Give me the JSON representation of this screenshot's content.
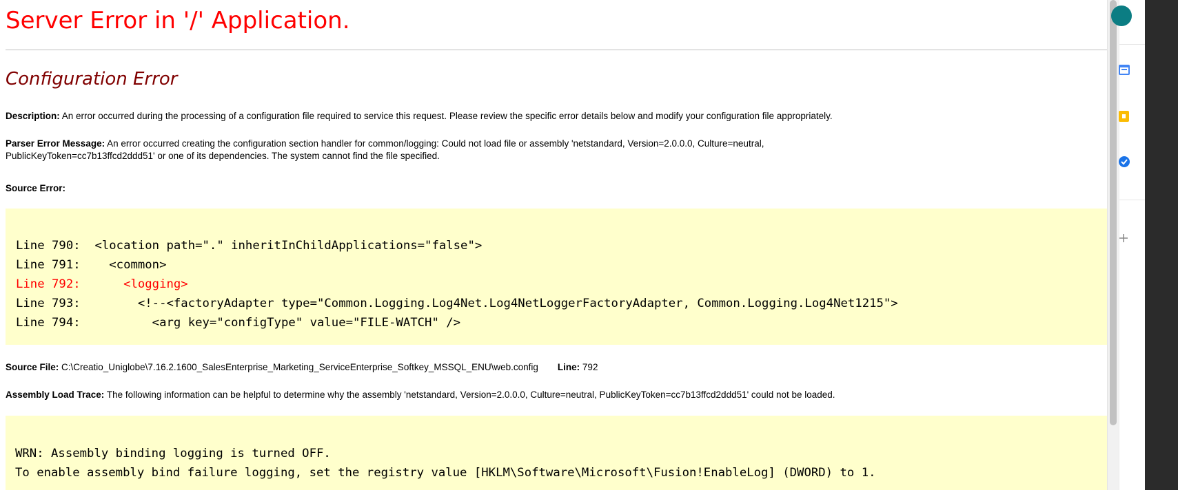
{
  "page": {
    "title": "Server Error in '/' Application.",
    "error_heading": "Configuration Error"
  },
  "description": {
    "label": "Description:",
    "text": " An error occurred during the processing of a configuration file required to service this request. Please review the specific error details below and modify your configuration file appropriately."
  },
  "parser_error": {
    "label": "Parser Error Message:",
    "line1": " An error occurred creating the configuration section handler for common/logging: Could not load file or assembly 'netstandard, Version=2.0.0.0, Culture=neutral,",
    "line2": "PublicKeyToken=cc7b13ffcd2ddd51' or one of its dependencies. The system cannot find the file specified."
  },
  "source_error": {
    "label": "Source Error:",
    "lines": [
      "Line 790:  <location path=\".\" inheritInChildApplications=\"false\">",
      "Line 791:    <common>",
      "Line 792:      <logging>",
      "Line 793:        <!--<factoryAdapter type=\"Common.Logging.Log4Net.Log4NetLoggerFactoryAdapter, Common.Logging.Log4Net1215\">",
      "Line 794:          <arg key=\"configType\" value=\"FILE-WATCH\" />"
    ]
  },
  "source_file": {
    "label": "Source File:",
    "path": " C:\\Creatio_Uniglobe\\7.16.2.1600_SalesEnterprise_Marketing_ServiceEnterprise_Softkey_MSSQL_ENU\\web.config",
    "line_label": "Line:",
    "line_value": " 792"
  },
  "assembly_trace": {
    "label": "Assembly Load Trace:",
    "text": " The following information can be helpful to determine why the assembly 'netstandard, Version=2.0.0.0, Culture=neutral, PublicKeyToken=cc7b13ffcd2ddd51' could not be loaded.",
    "lines": [
      "WRN: Assembly binding logging is turned OFF.",
      "To enable assembly bind failure logging, set the registry value [HKLM\\Software\\Microsoft\\Fusion!EnableLog] (DWORD) to 1."
    ]
  },
  "side_panel": {
    "icons": [
      "account-avatar-icon",
      "calendar-icon",
      "keep-notes-icon",
      "tasks-icon",
      "add-icon"
    ]
  },
  "colors": {
    "title": "#ff0000",
    "heading": "#800000",
    "code_bg": "#ffffcc",
    "error_line": "#ff0000"
  }
}
